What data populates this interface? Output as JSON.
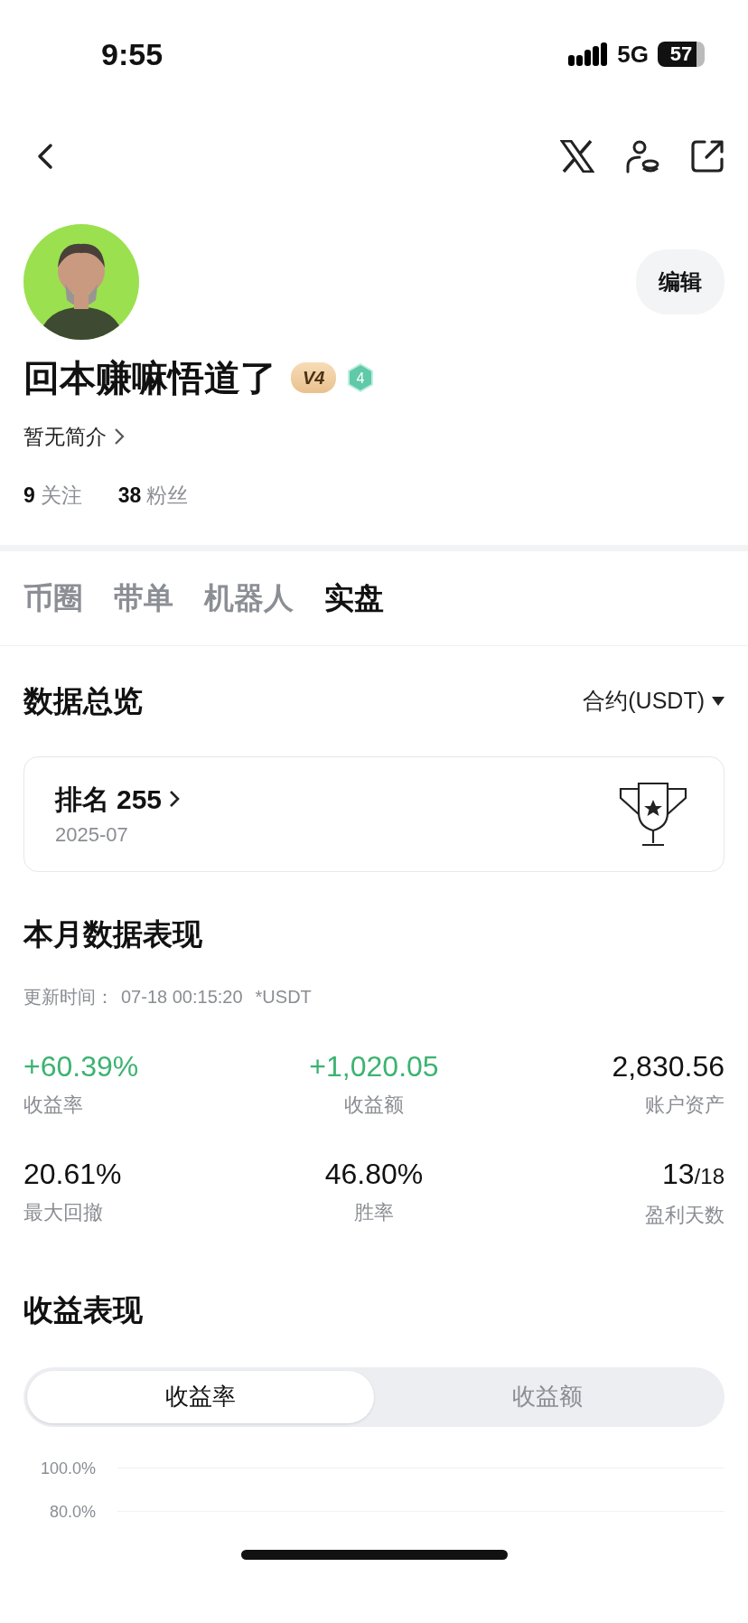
{
  "status_bar": {
    "time": "9:55",
    "network": "5G",
    "battery": "57"
  },
  "profile": {
    "name": "回本赚嘛悟道了",
    "vip_badge": "V4",
    "level_badge": "4",
    "bio": "暂无简介",
    "edit_button": "编辑",
    "following": {
      "count": "9",
      "label": "关注"
    },
    "followers": {
      "count": "38",
      "label": "粉丝"
    }
  },
  "tabs": [
    {
      "label": "币圈",
      "selected": false
    },
    {
      "label": "带单",
      "selected": false
    },
    {
      "label": "机器人",
      "selected": false
    },
    {
      "label": "实盘",
      "selected": true
    }
  ],
  "overview": {
    "title": "数据总览",
    "market_selector": "合约(USDT)",
    "rank": {
      "label": "排名",
      "value": "255",
      "period": "2025-07"
    }
  },
  "monthly": {
    "title": "本月数据表现",
    "updated": "更新时间：",
    "updated_time": "07-18 00:15:20",
    "unit": "*USDT",
    "metrics": [
      {
        "value": "+60.39%",
        "label": "收益率",
        "color": "#3cb371"
      },
      {
        "value": "+1,020.05",
        "label": "收益额",
        "color": "#3cb371"
      },
      {
        "value": "2,830.56",
        "label": "账户资产",
        "color": "#111111"
      },
      {
        "value": "20.61%",
        "label": "最大回撤",
        "color": "#111111"
      },
      {
        "value": "46.80%",
        "label": "胜率",
        "color": "#111111"
      },
      {
        "value": "13",
        "suffix": "/18",
        "label": "盈利天数",
        "color": "#111111"
      }
    ]
  },
  "performance": {
    "title": "收益表现",
    "toggle": [
      {
        "label": "收益率",
        "selected": true
      },
      {
        "label": "收益额",
        "selected": false
      }
    ],
    "y_ticks": [
      "100.0%",
      "80.0%"
    ]
  }
}
